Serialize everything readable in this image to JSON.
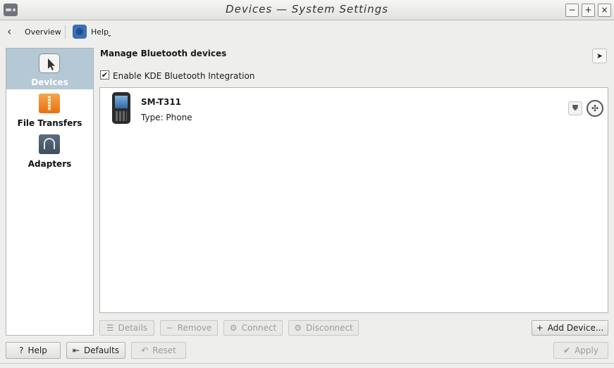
{
  "window": {
    "title": "Devices — System Settings",
    "controls": {
      "minimize": "−",
      "maximize": "+",
      "close": "×"
    }
  },
  "toolbar": {
    "back_glyph": "‹",
    "overview_label": "Overview",
    "help_label": "Help",
    "help_arrow": "⌄"
  },
  "sidebar": {
    "items": [
      {
        "label": "Devices",
        "icon": "pointer-icon",
        "active": true
      },
      {
        "label": "File Transfers",
        "icon": "zip-archive-icon",
        "active": false
      },
      {
        "label": "Adapters",
        "icon": "headphones-icon",
        "active": false
      }
    ]
  },
  "content": {
    "title": "Manage Bluetooth devices",
    "whatsthis_glyph": "➤",
    "enable_checkbox": {
      "label": "Enable KDE Bluetooth Integration",
      "checked": true,
      "mark": "✔"
    },
    "devices": [
      {
        "name": "SM-T311",
        "type": "Type: Phone"
      }
    ],
    "device_trust_glyph": "⛊",
    "device_settings_glyph": "✣",
    "action_buttons": {
      "details": "Details",
      "remove": "Remove",
      "connect": "Connect",
      "disconnect": "Disconnect",
      "add_device": "Add Device..."
    }
  },
  "footer": {
    "help": "Help",
    "defaults": "Defaults",
    "reset": "Reset",
    "apply": "Apply"
  },
  "colors": {
    "window_bg": "#eeeeec",
    "selection": "#b5c8d6"
  }
}
